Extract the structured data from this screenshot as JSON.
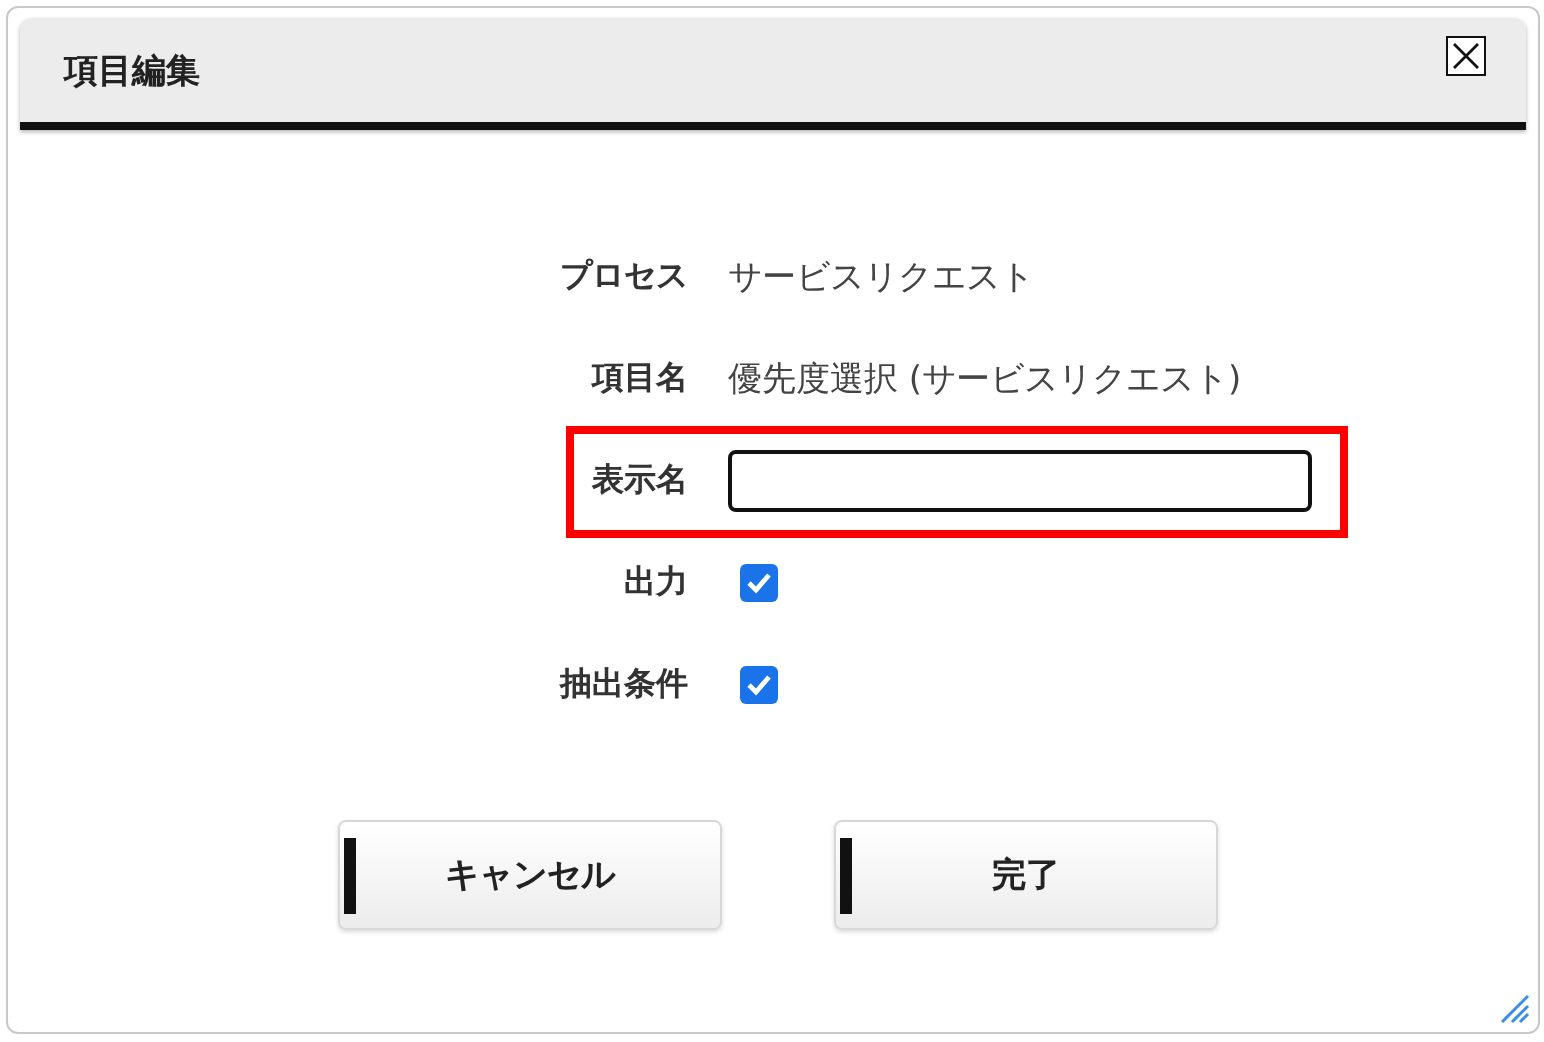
{
  "dialog": {
    "title": "項目編集"
  },
  "fields": [
    {
      "kind": "text",
      "label": "プロセス",
      "value": "サービスリクエスト",
      "highlighted": false
    },
    {
      "kind": "text",
      "label": "項目名",
      "value": "優先度選択 (サービスリクエスト)",
      "highlighted": false
    },
    {
      "kind": "input",
      "label": "表示名",
      "highlighted": true
    },
    {
      "kind": "checkbox",
      "label": "出力",
      "checked": true,
      "highlighted": false
    },
    {
      "kind": "checkbox",
      "label": "抽出条件",
      "checked": true,
      "highlighted": false
    }
  ],
  "buttons": [
    {
      "label": "キャンセル"
    },
    {
      "label": "完了"
    }
  ]
}
